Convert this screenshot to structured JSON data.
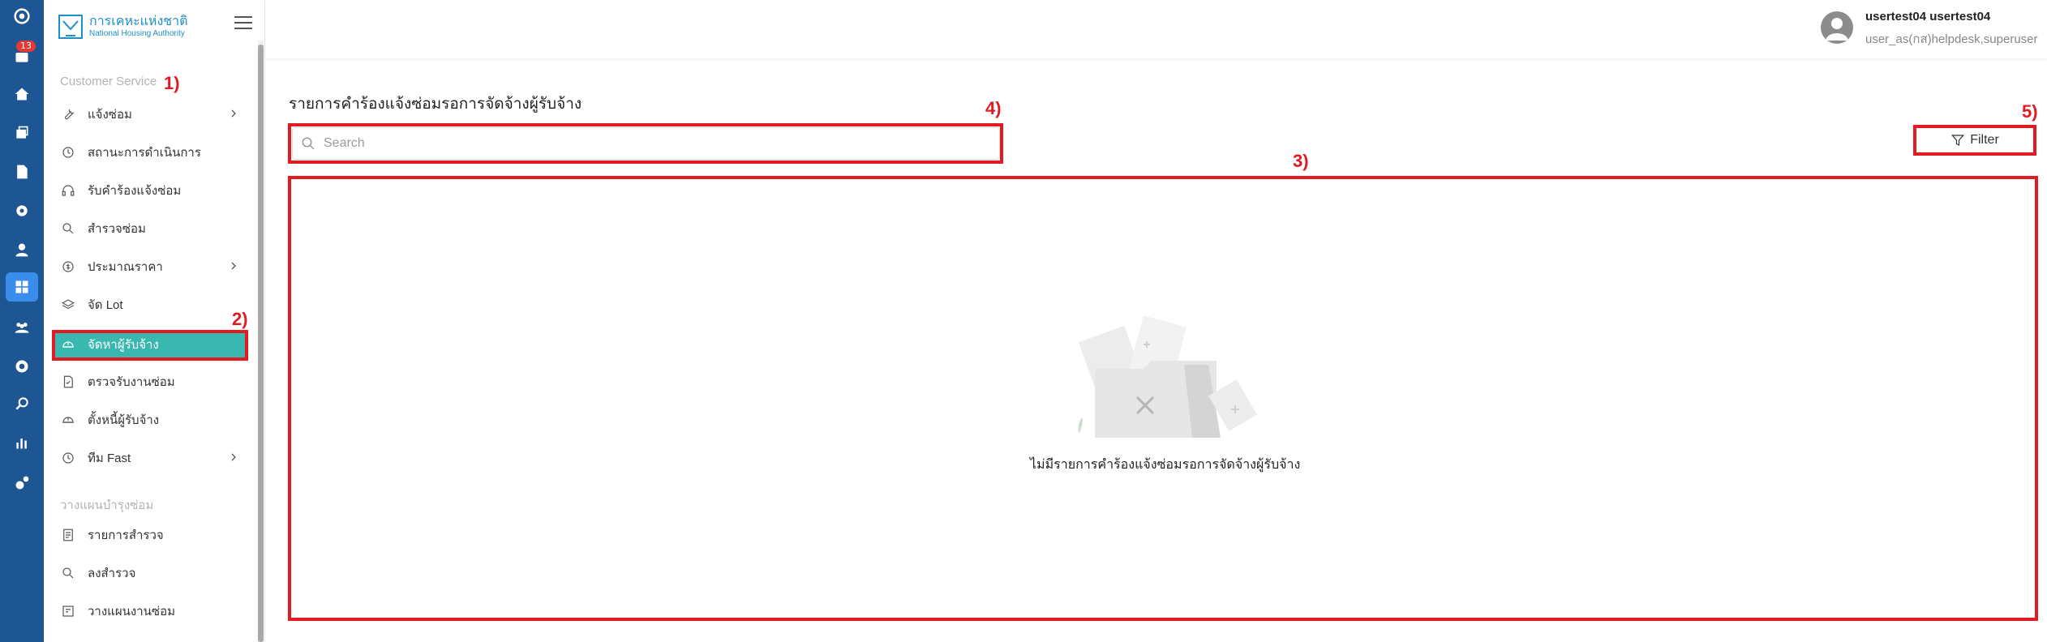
{
  "rail": {
    "badge": "13",
    "icons": [
      "logo-icon",
      "inbox-icon",
      "home-icon",
      "layers-icon",
      "document-icon",
      "settings-cog-icon",
      "user-icon",
      "dashboard-icon",
      "team-icon",
      "gear-icon",
      "search-icon",
      "chart-icon",
      "tools-icon"
    ]
  },
  "sidebar": {
    "brand_th": "การเคหะแห่งชาติ",
    "brand_en": "National Housing Authority",
    "section1": "Customer Service",
    "items": [
      {
        "label": "แจ้งซ่อม",
        "icon": "wrench-icon",
        "has_chevron": true
      },
      {
        "label": "สถานะการดำเนินการ",
        "icon": "history-icon",
        "has_chevron": false
      },
      {
        "label": "รับคำร้องแจ้งซ่อม",
        "icon": "headset-icon",
        "has_chevron": false
      },
      {
        "label": "สำรวจซ่อม",
        "icon": "search-icon",
        "has_chevron": false
      },
      {
        "label": "ประมาณราคา",
        "icon": "coin-icon",
        "has_chevron": true
      },
      {
        "label": "จัด Lot",
        "icon": "stack-icon",
        "has_chevron": false
      },
      {
        "label": "จัดหาผู้รับจ้าง",
        "icon": "helmet-icon",
        "has_chevron": false,
        "active": true
      },
      {
        "label": "ตรวจรับงานซ่อม",
        "icon": "doc-check-icon",
        "has_chevron": false
      },
      {
        "label": "ตั้งหนี้ผู้รับจ้าง",
        "icon": "helmet-icon",
        "has_chevron": false
      },
      {
        "label": "ทีม Fast",
        "icon": "history-icon",
        "has_chevron": true
      }
    ],
    "section2": "วางแผนบำรุงซ่อม",
    "items2": [
      {
        "label": "รายการสำรวจ",
        "icon": "list-icon"
      },
      {
        "label": "ลงสำรวจ",
        "icon": "search-icon"
      },
      {
        "label": "วางแผนงานซ่อม",
        "icon": "plan-icon"
      }
    ]
  },
  "header": {
    "user_name": "usertest04 usertest04",
    "user_role": "user_as(กส)helpdesk,superuser"
  },
  "main": {
    "title": "รายการคำร้องแจ้งซ่อมรอการจัดจ้างผู้รับจ้าง",
    "search_placeholder": "Search",
    "filter_label": "Filter",
    "empty_text": "ไม่มีรายการคำร้องแจ้งซ่อมรอการจัดจ้างผู้รับจ้าง"
  },
  "annotations": [
    "1)",
    "2)",
    "3)",
    "4)",
    "5)"
  ],
  "colors": {
    "rail": "#1e5694",
    "active_item": "#3ab8b0",
    "annotation": "#e01b22"
  }
}
